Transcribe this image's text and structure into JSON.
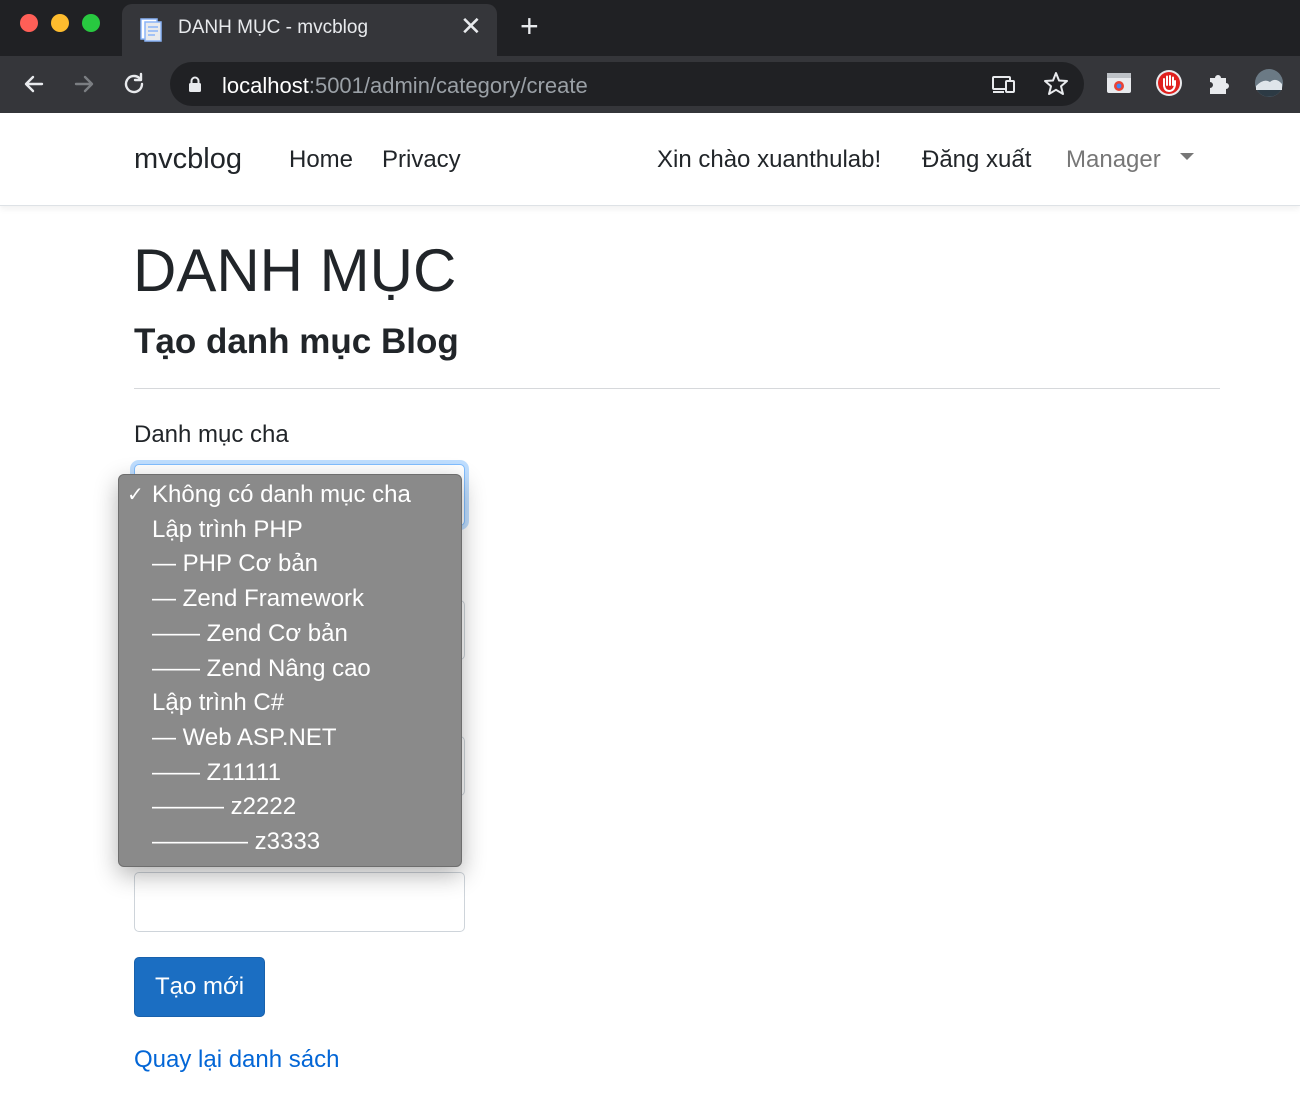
{
  "browser": {
    "tab_title": "DANH MỤC - mvcblog",
    "close_glyph": "✕",
    "new_tab_glyph": "+",
    "url_host": "localhost",
    "url_rest": ":5001/admin/category/create"
  },
  "navbar": {
    "brand": "mvcblog",
    "links": [
      "Home",
      "Privacy"
    ],
    "greeting": "Xin chào xuanthulab!",
    "logout": "Đăng xuất",
    "manager": "Manager"
  },
  "page": {
    "title": "DANH MỤC",
    "subtitle": "Tạo danh mục Blog",
    "parent_label": "Danh mục cha",
    "create_button": "Tạo mới",
    "back_link": "Quay lại danh sách"
  },
  "dropdown": {
    "check_glyph": "✓",
    "selected_index": 0,
    "options": [
      "Không có danh mục cha",
      "Lập trình PHP",
      "— PHP Cơ bản",
      "— Zend Framework",
      "—— Zend Cơ bản",
      "—— Zend Nâng cao",
      "Lập trình C#",
      "— Web ASP.NET",
      "—— Z11111",
      "——— z2222",
      "———— z3333"
    ]
  },
  "colors": {
    "primary": "#1b6ec2",
    "link": "#0366d6",
    "dropdown_bg": "#8a8a8a",
    "focus_ring": "#80bdff"
  }
}
